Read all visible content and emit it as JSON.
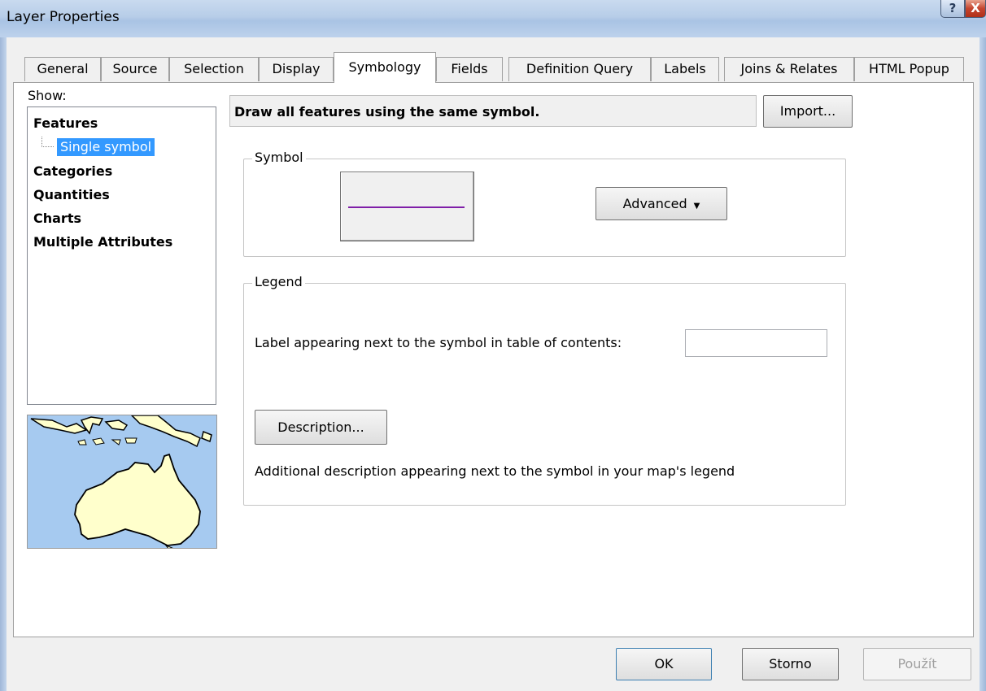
{
  "window": {
    "title": "Layer Properties",
    "help_glyph": "?",
    "close_glyph": "X"
  },
  "tabs": [
    {
      "label": "General"
    },
    {
      "label": "Source"
    },
    {
      "label": "Selection"
    },
    {
      "label": "Display"
    },
    {
      "label": "Symbology",
      "active": true
    },
    {
      "label": "Fields"
    },
    {
      "label": "Definition Query"
    },
    {
      "label": "Labels"
    },
    {
      "label": "Joins & Relates"
    },
    {
      "label": "HTML Popup"
    }
  ],
  "show": {
    "label": "Show:",
    "tree": {
      "features": "Features",
      "single_symbol": "Single symbol",
      "categories": "Categories",
      "quantities": "Quantities",
      "charts": "Charts",
      "multiple_attributes": "Multiple Attributes"
    }
  },
  "symbology": {
    "description": "Draw all features using the same symbol.",
    "import_label": "Import...",
    "symbol_group": "Symbol",
    "symbol_line_color": "#7f1fa8",
    "advanced_label": "Advanced",
    "advanced_arrow": "▼",
    "legend_group": "Legend",
    "label_prompt": "Label appearing next to the symbol in table of contents:",
    "label_value": "",
    "description_button": "Description...",
    "additional_description": "Additional description appearing next to the symbol in your map's legend"
  },
  "footer": {
    "ok": "OK",
    "cancel": "Storno",
    "apply": "Použít"
  }
}
